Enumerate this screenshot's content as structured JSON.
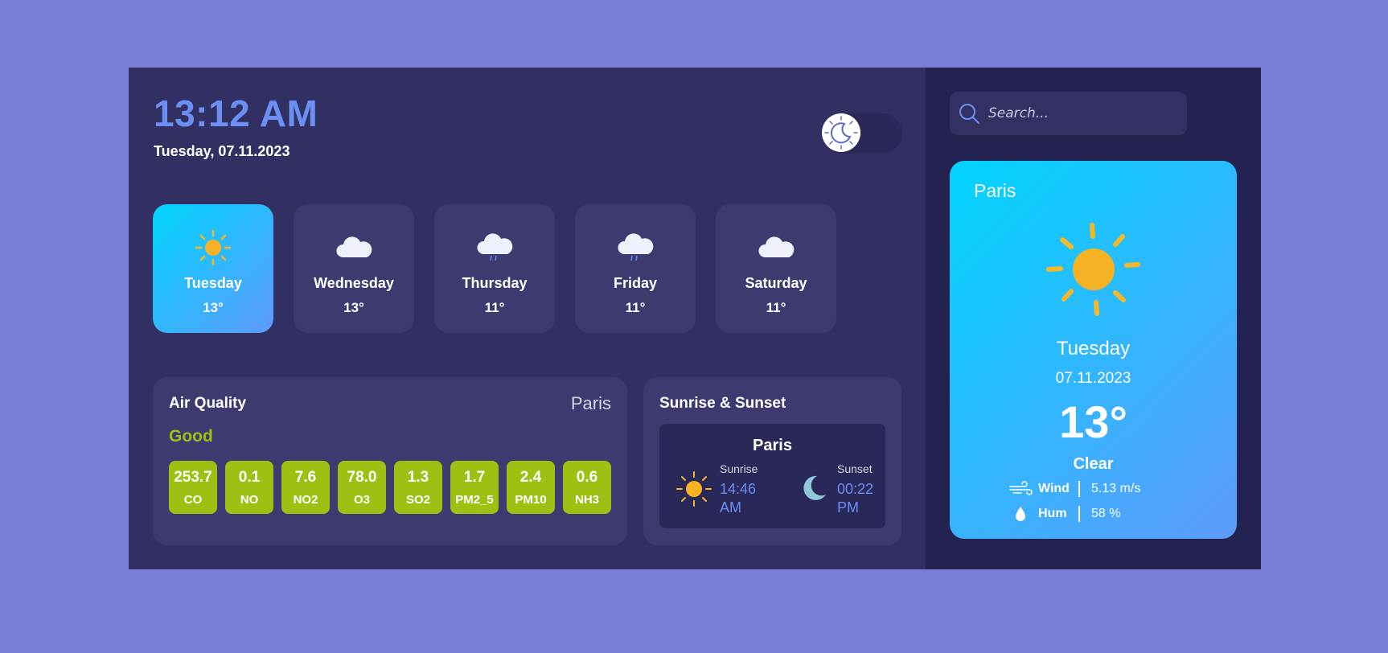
{
  "header": {
    "time": "13:12 AM",
    "date": "Tuesday, 07.11.2023"
  },
  "theme_toggle": {
    "icon": "moon-icon"
  },
  "forecast": [
    {
      "day": "Tuesday",
      "temp": "13°",
      "icon": "sun-icon",
      "active": true
    },
    {
      "day": "Wednesday",
      "temp": "13°",
      "icon": "cloud-icon",
      "active": false
    },
    {
      "day": "Thursday",
      "temp": "11°",
      "icon": "cloud-drizzle-icon",
      "active": false
    },
    {
      "day": "Friday",
      "temp": "11°",
      "icon": "cloud-drizzle-icon",
      "active": false
    },
    {
      "day": "Saturday",
      "temp": "11°",
      "icon": "cloud-icon",
      "active": false
    }
  ],
  "air_quality": {
    "title": "Air Quality",
    "city": "Paris",
    "status": "Good",
    "status_color": "#9ec012",
    "items": [
      {
        "value": "253.7",
        "name": "CO"
      },
      {
        "value": "0.1",
        "name": "NO"
      },
      {
        "value": "7.6",
        "name": "NO2"
      },
      {
        "value": "78.0",
        "name": "O3"
      },
      {
        "value": "1.3",
        "name": "SO2"
      },
      {
        "value": "1.7",
        "name": "PM2_5"
      },
      {
        "value": "2.4",
        "name": "PM10"
      },
      {
        "value": "0.6",
        "name": "NH3"
      }
    ]
  },
  "sun": {
    "title": "Sunrise & Sunset",
    "city": "Paris",
    "sunrise_label": "Sunrise",
    "sunrise_time": "14:46 AM",
    "sunset_label": "Sunset",
    "sunset_time": "00:22 PM"
  },
  "search": {
    "placeholder": "Search..."
  },
  "current": {
    "city": "Paris",
    "day": "Tuesday",
    "date": "07.11.2023",
    "temp": "13°",
    "condition": "Clear",
    "wind_label": "Wind",
    "wind_value": "5.13 m/s",
    "hum_label": "Hum",
    "hum_value": "58 %"
  },
  "colors": {
    "background": "#787fd4",
    "panel": "#323063",
    "sidebar": "#232251",
    "accent": "#6b8ff2",
    "gradient_start": "#00d4ff",
    "gradient_end": "#5f9bfb"
  }
}
